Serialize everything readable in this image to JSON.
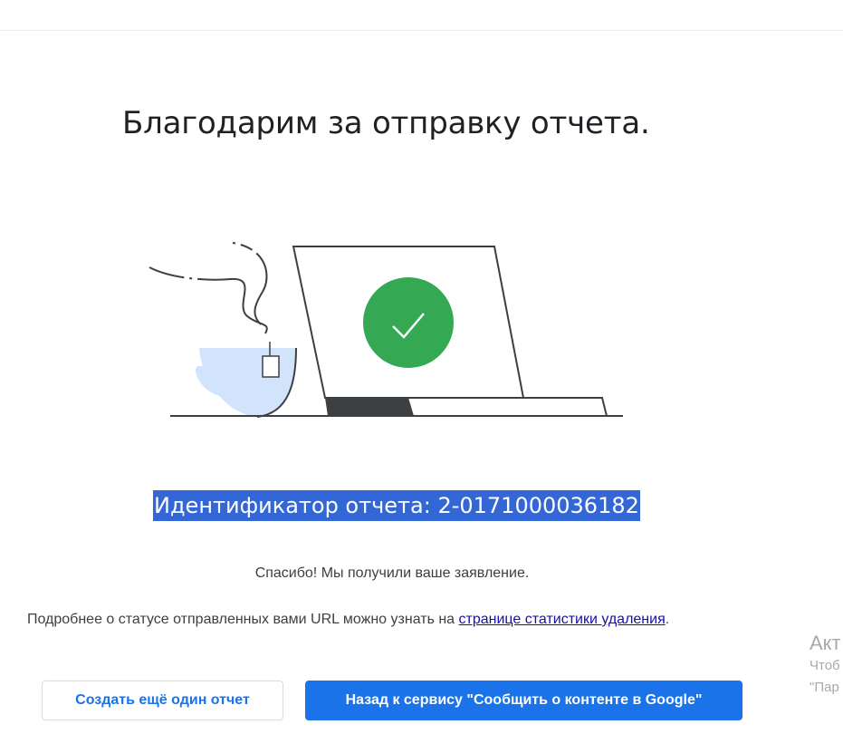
{
  "page": {
    "title": "Благодарим за отправку отчета.",
    "report_id": "Идентификатор отчета: 2-0171000036182",
    "thanks_text": "Спасибо! Мы получили ваше заявление.",
    "status_text_before": "Подробнее о статусе отправленных вами URL можно узнать на ",
    "status_link_text": "странице статистики удаления",
    "status_text_after": "."
  },
  "illustration": {
    "icon": "checkmark-icon",
    "accent_color": "#34a853",
    "cup_color": "#d2e3fc"
  },
  "buttons": {
    "create_another": "Создать ещё один отчет",
    "back_to_service": "Назад к сервису \"Сообщить о контенте в Google\""
  },
  "overlay": {
    "title": "Акт",
    "line1": "Чтоб",
    "line2": "\"Пар"
  },
  "colors": {
    "primary": "#1a73e8",
    "selection": "#3367d6",
    "link": "#1a0dab"
  }
}
